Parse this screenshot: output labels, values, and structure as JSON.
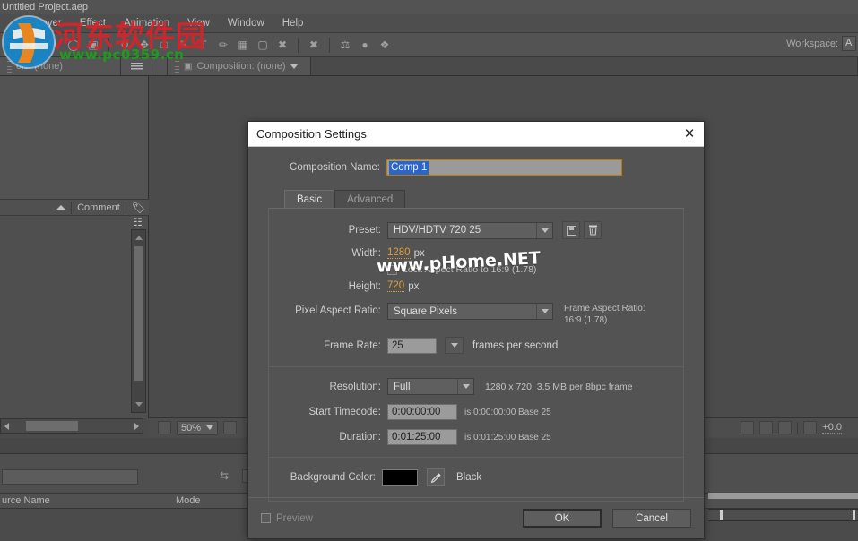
{
  "colors": {
    "accent_orange": "#d9a23c",
    "field_border_focus": "#b07a28",
    "selection_blue": "#2a66c8",
    "dialog_bg": "#535353",
    "titlebar_bg": "#ffffff",
    "background_color_value": "#000000",
    "watermark_red": "#d8232a",
    "watermark_green": "#1f9a1f"
  },
  "app": {
    "window_title": "Untitled Project.aep",
    "menu_items": [
      {
        "label": "Layer"
      },
      {
        "label": "Effect"
      },
      {
        "label": "Animation"
      },
      {
        "label": "View"
      },
      {
        "label": "Window"
      },
      {
        "label": "Help"
      }
    ],
    "workspace_label": "Workspace:",
    "workspace_value": "A"
  },
  "panels": {
    "effect_controls_tab": "ols: (none)",
    "composition_tab": "Composition: (none)",
    "comment_column": "Comment",
    "zoom_value": "50%",
    "offset_value": "+0.0"
  },
  "timeline": {
    "columns": [
      {
        "label": "urce Name"
      },
      {
        "label": "Mode"
      }
    ]
  },
  "dialog": {
    "title": "Composition Settings",
    "close_icon": "✕",
    "composition_name_label": "Composition Name:",
    "composition_name_value": "Comp 1",
    "tabs": [
      {
        "label": "Basic",
        "active": true
      },
      {
        "label": "Advanced",
        "active": false
      }
    ],
    "preset_label": "Preset:",
    "preset_value": "HDV/HDTV 720 25",
    "preset_save_icon": "save-preset-icon",
    "preset_delete_icon": "trash-icon",
    "width_label": "Width:",
    "width_value": "1280",
    "width_unit": "px",
    "height_label": "Height:",
    "height_value": "720",
    "height_unit": "px",
    "lock_aspect_label": "Lock Aspect Ratio to 16:9 (1.78)",
    "pixel_aspect_label": "Pixel Aspect Ratio:",
    "pixel_aspect_value": "Square Pixels",
    "frame_aspect_title": "Frame Aspect Ratio:",
    "frame_aspect_value": "16:9 (1.78)",
    "frame_rate_label": "Frame Rate:",
    "frame_rate_value": "25",
    "frame_rate_unit": "frames per second",
    "resolution_label": "Resolution:",
    "resolution_value": "Full",
    "resolution_note": "1280 x 720, 3.5 MB per 8bpc frame",
    "start_timecode_label": "Start Timecode:",
    "start_timecode_value": "0:00:00:00",
    "start_timecode_note": "is 0:00:00:00  Base 25",
    "duration_label": "Duration:",
    "duration_value": "0:01:25:00",
    "duration_note": "is 0:01:25:00  Base 25",
    "background_color_label": "Background Color:",
    "background_color_name": "Black",
    "eyedropper_icon": "eyedropper-icon",
    "preview_label": "Preview",
    "ok_label": "OK",
    "cancel_label": "Cancel"
  },
  "watermarks": {
    "site_cn": "河东软件园",
    "site_url": "www.pc0359.cn",
    "center_text": "www.pHome.NET"
  }
}
